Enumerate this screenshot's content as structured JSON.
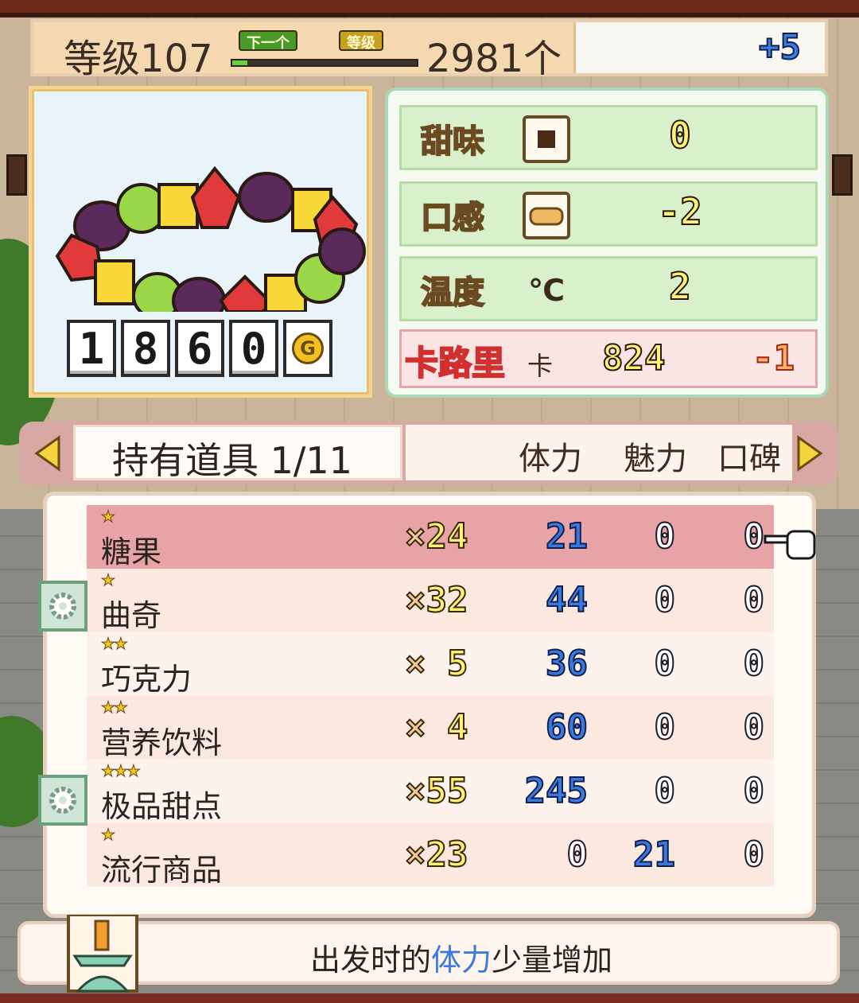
{
  "header": {
    "level_text": "等级107",
    "progress_tag_next": "下一个",
    "progress_tag_level": "等级",
    "progress_fraction": 0.08,
    "remaining_text": "2981个",
    "bonus_text": "+5"
  },
  "food": {
    "price_digits": [
      "1",
      "8",
      "6",
      "0"
    ],
    "currency_symbol": "G"
  },
  "stats": {
    "sweetness": {
      "label": "甜味",
      "icon": "square-dot-icon",
      "value": "0"
    },
    "texture": {
      "label": "口感",
      "icon": "bread-icon",
      "value": "-2"
    },
    "temperature": {
      "label": "温度",
      "icon_text": "℃",
      "value": "2"
    },
    "calories": {
      "label": "卡路里",
      "unit": "卡",
      "value": "824",
      "delta": "-1"
    }
  },
  "inventory": {
    "title": "持有道具 1/11",
    "columns": {
      "stamina": "体力",
      "charm": "魅力",
      "reputation": "口碑"
    },
    "items": [
      {
        "stars": "★",
        "name": "糖果",
        "qty": "24",
        "stamina": "21",
        "charm": "0",
        "reputation": "0",
        "selected": true
      },
      {
        "stars": "★",
        "name": "曲奇",
        "qty": "32",
        "stamina": "44",
        "charm": "0",
        "reputation": "0"
      },
      {
        "stars": "★★",
        "name": "巧克力",
        "qty": "5",
        "stamina": "36",
        "charm": "0",
        "reputation": "0"
      },
      {
        "stars": "★★",
        "name": "营养饮料",
        "qty": "4",
        "stamina": "60",
        "charm": "0",
        "reputation": "0"
      },
      {
        "stars": "★★★",
        "name": "极品甜点",
        "qty": "55",
        "stamina": "245",
        "charm": "0",
        "reputation": "0"
      },
      {
        "stars": "★",
        "name": "流行商品",
        "qty": "23",
        "stamina": "0",
        "charm": "21",
        "reputation": "0"
      }
    ],
    "qty_prefix": "×"
  },
  "footer": {
    "text_before": "出发时的",
    "text_highlight": "体力",
    "text_after": "少量增加"
  },
  "colors": {
    "accent_blue": "#3a7ae0",
    "selected_row": "#e7a3a6",
    "calorie_red": "#d03030"
  }
}
